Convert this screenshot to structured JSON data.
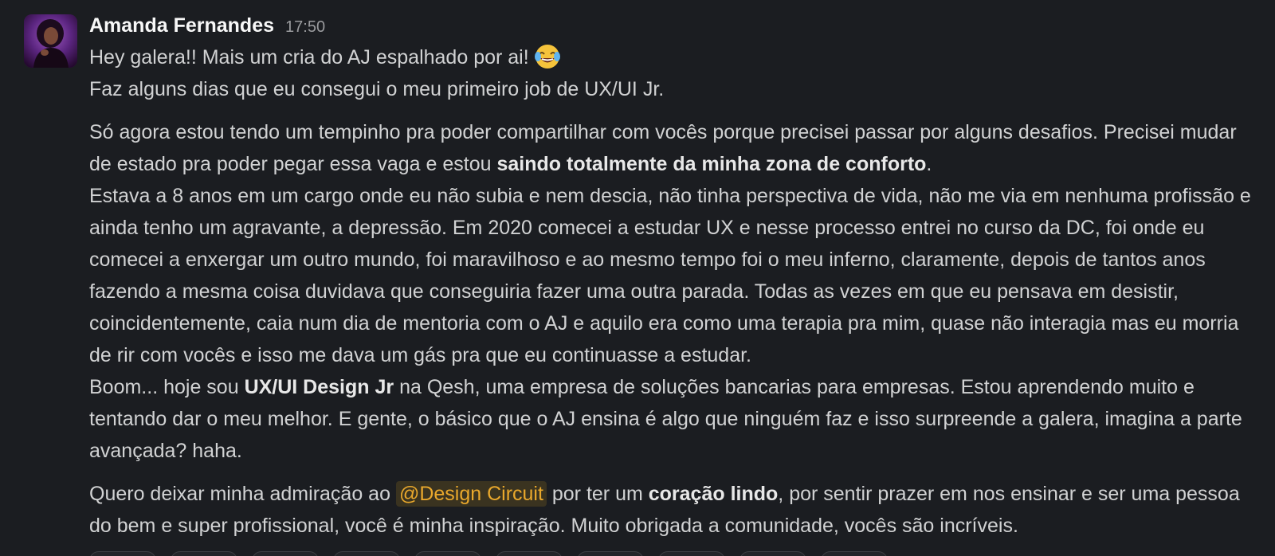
{
  "message": {
    "author": "Amanda Fernandes",
    "time": "17:50",
    "avatar_icon": "user-avatar-photo",
    "line1": "Hey galera!! Mais um cria do AJ espalhado por ai!",
    "line1_emoji": "face-with-tears-of-joy-emoji",
    "line2": "Faz alguns dias que eu consegui o meu primeiro job de UX/UI Jr.",
    "para2_before": "Só agora estou tendo um tempinho pra poder compartilhar com vocês porque precisei passar por alguns desafios. Precisei mudar de estado pra poder pegar essa vaga e estou ",
    "para2_bold": "saindo totalmente da minha zona de conforto",
    "para2_after": ".",
    "para3": "Estava a 8 anos em um cargo onde eu não subia e nem descia, não tinha perspectiva de vida, não me via em nenhuma profissão e ainda tenho um agravante, a depressão. Em 2020 comecei a estudar UX e nesse processo entrei no curso da DC, foi onde eu comecei a enxergar um outro mundo, foi maravilhoso e ao mesmo tempo foi o meu inferno, claramente, depois de tantos anos fazendo a mesma coisa duvidava que conseguiria fazer uma outra parada. Todas as vezes em que eu pensava em desistir, coincidentemente, caia num dia de mentoria com o AJ e aquilo era como uma terapia pra mim, quase não interagia mas eu morria de rir com vocês e isso me dava um gás pra que eu continuasse a estudar.",
    "para4_before": "Boom... hoje sou ",
    "para4_bold": "UX/UI Design Jr",
    "para4_after": " na Qesh, uma empresa de soluções bancarias para empresas. Estou aprendendo muito e tentando dar o meu melhor. E gente, o básico que o AJ ensina é algo que ninguém faz e isso surpreende a galera, imagina a parte avançada? haha.",
    "para5_before": "Quero deixar minha admiração ao ",
    "para5_mention": "@Design Circuit",
    "para5_middle": " por ter um ",
    "para5_bold": "coração lindo",
    "para5_after": ", por sentir prazer em nos ensinar e ser uma pessoa do bem e super profissional, você é minha inspiração. Muito obrigada a comunidade, vocês são incríveis."
  },
  "colors": {
    "background": "#1b1d21",
    "text": "#d1d2d3",
    "author": "#f8f8f8",
    "timestamp": "#9a9b9e",
    "mention_text": "#e9a82c",
    "mention_bg": "#3a3320"
  }
}
